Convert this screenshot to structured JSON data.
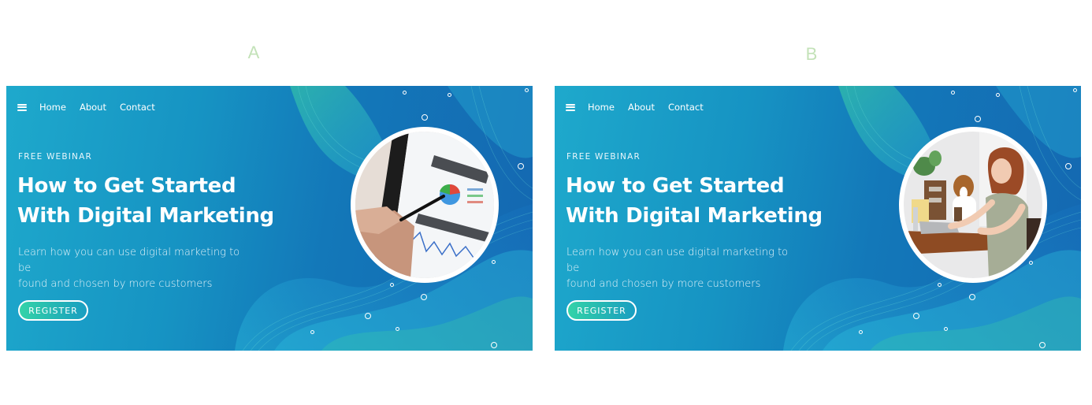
{
  "variants": [
    {
      "label": "A",
      "nav": {
        "items": [
          "Home",
          "About",
          "Contact"
        ]
      },
      "eyebrow": "FREE WEBINAR",
      "title_line1": "How to Get Started",
      "title_line2": "With Digital Marketing",
      "subtitle_line1": "Learn how you can use digital marketing to be",
      "subtitle_line2": "found and chosen by more customers",
      "cta_label": "REGISTER",
      "photo": "hand-with-stylus-pointing-at-analytics-dashboard-on-tablet"
    },
    {
      "label": "B",
      "nav": {
        "items": [
          "Home",
          "About",
          "Contact"
        ]
      },
      "eyebrow": "FREE WEBINAR",
      "title_line1": "How to Get Started",
      "title_line2": "With Digital Marketing",
      "subtitle_line1": "Learn how you can use digital marketing to be",
      "subtitle_line2": "found and chosen by more customers",
      "cta_label": "REGISTER",
      "photo": "woman-typing-on-laptop-with-beagle-dog"
    }
  ],
  "icons": {
    "menu": "hamburger-icon"
  },
  "colors": {
    "banner_start": "#1ea9cc",
    "banner_end": "#1467b1",
    "wave_green": "#3fd6a0",
    "wave_cyan": "#2fc3e0",
    "cta_green": "#34d3a8",
    "variant_label": "#c3e2b8"
  }
}
